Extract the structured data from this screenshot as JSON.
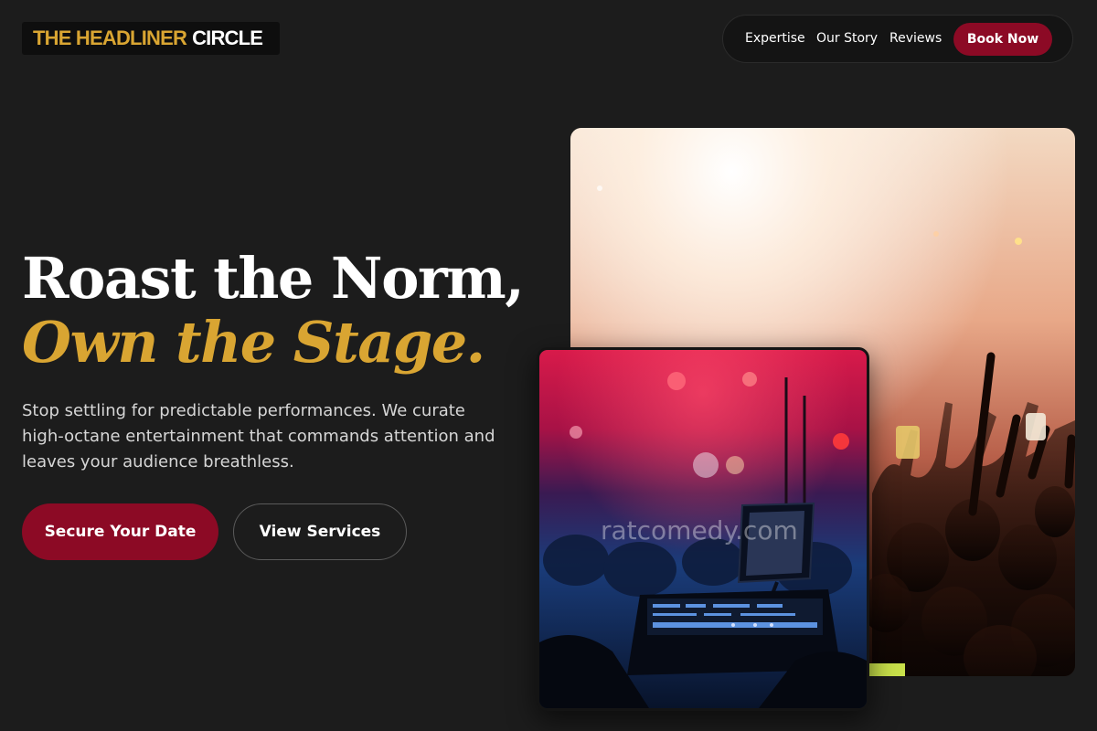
{
  "brand": {
    "name_part1": "THE HEADLINER",
    "name_part2": "CIRCLE"
  },
  "nav": {
    "links": [
      "Expertise",
      "Our Story",
      "Reviews"
    ],
    "cta": "Book Now"
  },
  "hero": {
    "headline_line1": "Roast the Norm,",
    "headline_line2": "Own the Stage.",
    "description": "Stop settling for predictable performances. We curate high-octane entertainment that commands attention and leaves your audience breathless.",
    "primary_button": "Secure Your Date",
    "secondary_button": "View Services"
  },
  "images": {
    "watermark": "ratcomedy.com"
  },
  "colors": {
    "background": "#1c1c1c",
    "accent_gold": "#d9a532",
    "accent_crimson": "#8c0a25"
  }
}
